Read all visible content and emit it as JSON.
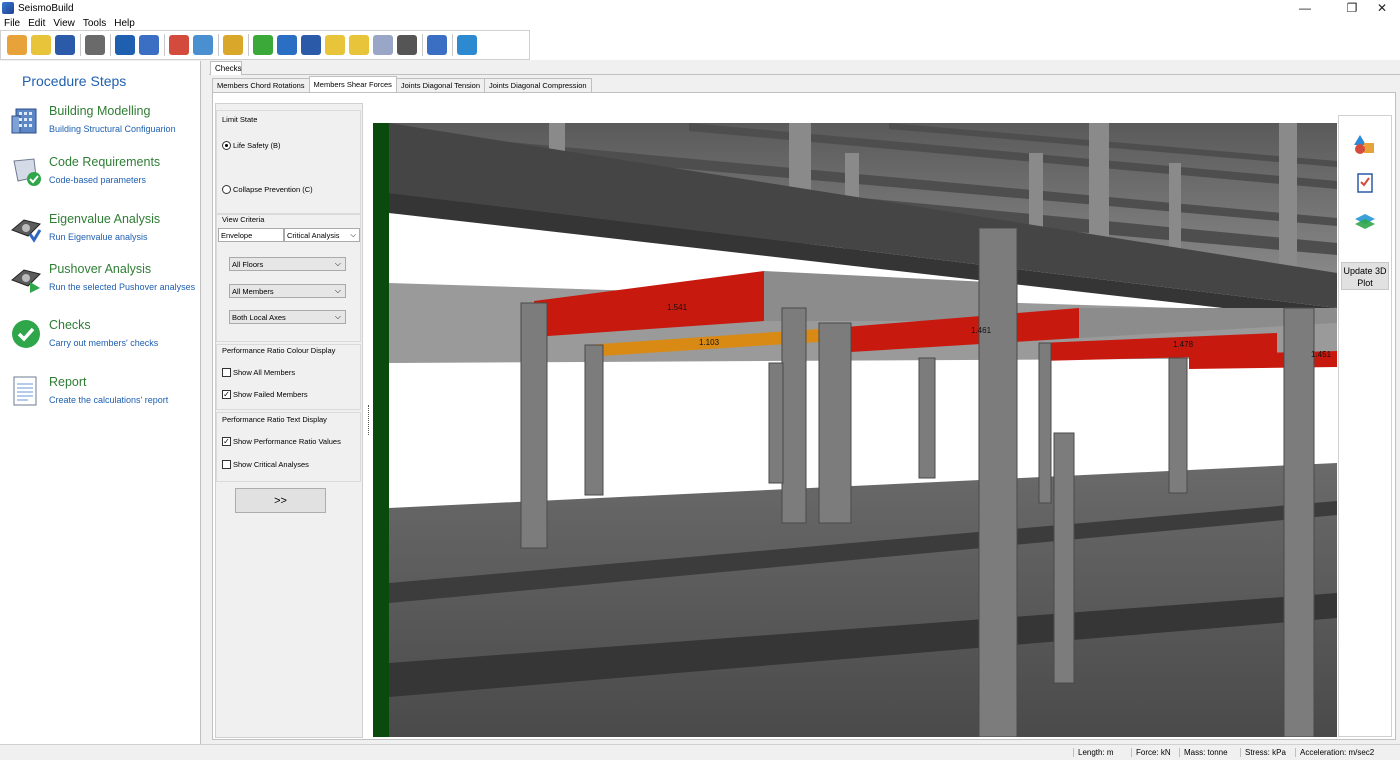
{
  "window": {
    "title": "SeismoBuild",
    "controls": {
      "minimize": "—",
      "restore": "❐",
      "close": "✕"
    }
  },
  "menu": [
    "File",
    "Edit",
    "View",
    "Tools",
    "Help"
  ],
  "toolbar": {
    "icons": [
      "new-file-icon",
      "open-folder-icon",
      "save-icon",
      "settings-gears-icon",
      "frame-icon",
      "copy-document-icon",
      "structure-model-icon",
      "calculator-icon",
      "brush-icon",
      "help-icon",
      "book-icon",
      "book-blue-icon",
      "folder-notes-icon",
      "folder-yellow-icon",
      "chat-icon",
      "film-icon",
      "edit-pen-icon",
      "globe-icon"
    ],
    "colors": [
      "#e8a23a",
      "#e8c43a",
      "#2b5aa8",
      "#6a6a6a",
      "#1f5fb0",
      "#3a6fc4",
      "#d24b3c",
      "#4a8fd0",
      "#d9a72a",
      "#3aa93a",
      "#2a6fc4",
      "#2a5aa8",
      "#e8c43a",
      "#e8c43a",
      "#9aa6c8",
      "#555555",
      "#3a6fc4",
      "#2e8ad0"
    ]
  },
  "procedure": {
    "heading": "Procedure Steps",
    "steps": [
      {
        "name": "Building Modelling",
        "desc": "Building Structural Configuarion",
        "icon": "building-icon"
      },
      {
        "name": "Code Requirements",
        "desc": "Code-based parameters",
        "icon": "scroll-check-icon"
      },
      {
        "name": "Eigenvalue Analysis",
        "desc": "Run Eigenvalue analysis",
        "icon": "eigenvalue-gear-icon"
      },
      {
        "name": "Pushover Analysis",
        "desc": "Run the selected Pushover analyses",
        "icon": "pushover-gear-icon"
      },
      {
        "name": "Checks",
        "desc": "Carry out members' checks",
        "icon": "green-check-icon"
      },
      {
        "name": "Report",
        "desc": "Create the calculations' report",
        "icon": "report-icon"
      }
    ]
  },
  "tabs": {
    "outer": "Checks",
    "inner": [
      "Members Chord Rotations",
      "Members Shear Forces",
      "Joints Diagonal Tension",
      "Joints Diagonal Compression"
    ],
    "active_inner": "Members Shear Forces"
  },
  "controls": {
    "limit_state_label": "Limit State",
    "life_safety": "Life Safety (B)",
    "collapse_prevention": "Collapse Prevention (C)",
    "view_criteria_label": "View Criteria",
    "envelope": "Envelope",
    "critical_analysis": "Critical Analysis",
    "floors": "All Floors",
    "members": "All Members",
    "axes": "Both Local Axes",
    "colour_display_label": "Performance Ratio Colour Display",
    "show_all_members": "Show All Members",
    "show_failed_members": "Show Failed Members",
    "text_display_label": "Performance Ratio Text Display",
    "show_ratio_values": "Show Performance Ratio Values",
    "show_critical_analyses": "Show Critical Analyses",
    "go_button": ">>",
    "checked": {
      "life_safety": true,
      "show_all_members": false,
      "show_failed_members": true,
      "show_ratio_values": true,
      "show_critical_analyses": false
    }
  },
  "view3d": {
    "ratio_labels": [
      "1.541",
      "1.103",
      "1.461",
      "1.478",
      "1.451"
    ],
    "beam_colors": {
      "failed": "#c8190f",
      "warning": "#d98a14",
      "concrete": "#7a7a7a"
    }
  },
  "side": {
    "icons": [
      "shapes-icon",
      "checklist-icon",
      "layers-icon"
    ],
    "update_button": "Update 3D Plot"
  },
  "status": {
    "length": "Length: m",
    "force": "Force: kN",
    "mass": "Mass: tonne",
    "stress": "Stress: kPa",
    "acceleration": "Acceleration: m/sec2"
  }
}
